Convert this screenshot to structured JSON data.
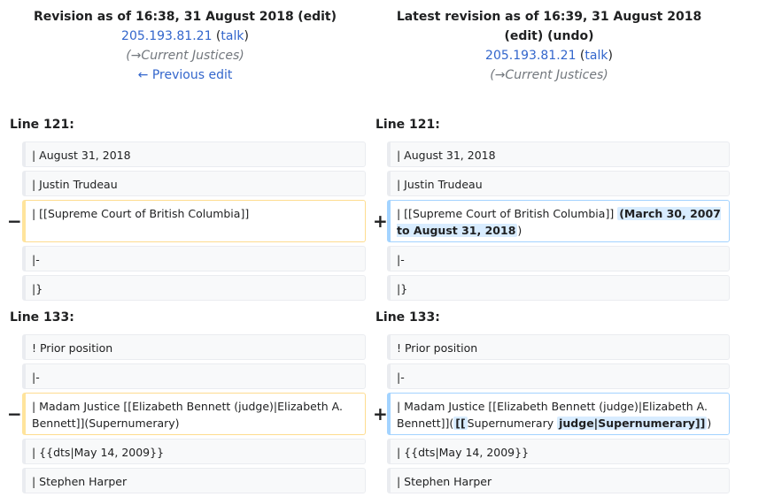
{
  "left_header": {
    "title": "Revision as of 16:38, 31 August 2018",
    "edit_label": "edit",
    "user": "205.193.81.21",
    "talk_label": "talk",
    "comment_arrow": "→",
    "comment": "Current Justices",
    "prev_edit": "← Previous edit"
  },
  "right_header": {
    "title": "Latest revision as of 16:39, 31 August 2018",
    "edit_label": "edit",
    "undo_label": "undo",
    "user": "205.193.81.21",
    "talk_label": "talk",
    "comment_arrow": "→",
    "comment": "Current Justices"
  },
  "block1": {
    "line_label": "Line 121:",
    "ctx1": "| August 31, 2018",
    "ctx2": "| Justin Trudeau",
    "del_text": "| [[Supreme Court of British Columbia]]",
    "add_text": "| [[Supreme Court of British Columbia]]",
    "add_ins": "(March 30, 2007 to August 31, 2018",
    "add_tail": ")",
    "ctx3": "|-",
    "ctx4": "|}"
  },
  "block2": {
    "line_label": "Line 133:",
    "ctx1": "! Prior position",
    "ctx2": "|-",
    "del_text": "| Madam Justice [[Elizabeth Bennett (judge)|Elizabeth A. Bennett]](Supernumerary)",
    "add_pre": "| Madam Justice [[Elizabeth Bennett (judge)|Elizabeth A. Bennett]](",
    "add_ins1": "[[",
    "add_mid": "Supernumerary",
    "add_ins2": "judge|Supernumerary]]",
    "add_tail": ")",
    "ctx3": "| {{dts|May 14, 2009}}",
    "ctx4": "| Stephen Harper"
  },
  "markers": {
    "minus": "−",
    "plus": "+"
  }
}
